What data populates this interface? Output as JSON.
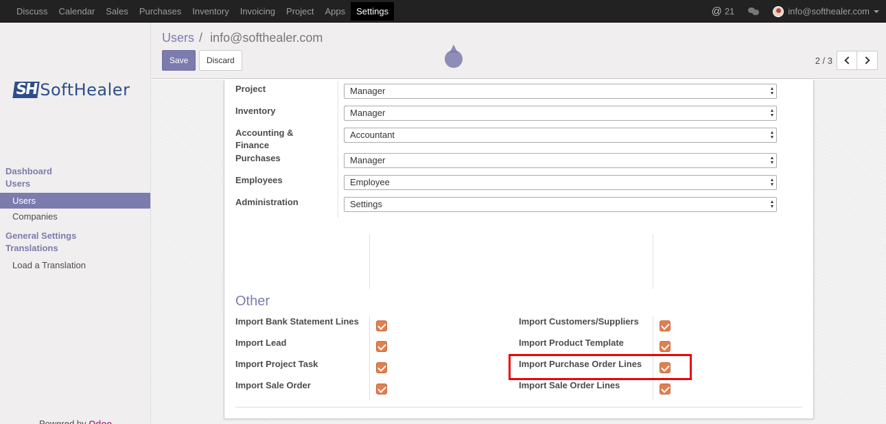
{
  "topbar": {
    "menu": [
      "Discuss",
      "Calendar",
      "Sales",
      "Purchases",
      "Inventory",
      "Invoicing",
      "Project",
      "Apps",
      "Settings"
    ],
    "active": "Settings",
    "mentions_count": "21",
    "user": "info@softhealer.com",
    "icons": {
      "mentions": "at-icon",
      "chat": "chat-icon",
      "user": "avatar"
    }
  },
  "sidebar": {
    "logo_mark": "SH",
    "logo_text": "SoftHealer",
    "groups": [
      {
        "label": "Dashboard",
        "items": []
      },
      {
        "label": "Users",
        "items": [
          "Users",
          "Companies"
        ]
      },
      {
        "label": "General Settings",
        "items": []
      },
      {
        "label": "Translations",
        "items": [
          "Load a Translation"
        ]
      }
    ],
    "active_item": "Users",
    "powered_prefix": "Powered by",
    "powered_brand": "Odoo"
  },
  "control": {
    "breadcrumb_parent": "Users",
    "breadcrumb_sep": "/",
    "breadcrumb_current": "info@softhealer.com",
    "save_label": "Save",
    "discard_label": "Discard",
    "pager": "2 / 3"
  },
  "access_rights": [
    {
      "label": "Project",
      "value": "Manager"
    },
    {
      "label": "Inventory",
      "value": "Manager"
    },
    {
      "label": "Accounting &\nFinance",
      "value": "Accountant"
    },
    {
      "label": "Purchases",
      "value": "Manager"
    },
    {
      "label": "Employees",
      "value": "Employee"
    },
    {
      "label": "Administration",
      "value": "Settings"
    }
  ],
  "other": {
    "title": "Other",
    "left": [
      {
        "label": "Import Bank Statement Lines",
        "checked": true
      },
      {
        "label": "Import Lead",
        "checked": true
      },
      {
        "label": "Import Project Task",
        "checked": true
      },
      {
        "label": "Import Sale Order",
        "checked": true
      }
    ],
    "right": [
      {
        "label": "Import Customers/Suppliers",
        "checked": true
      },
      {
        "label": "Import Product Template",
        "checked": true
      },
      {
        "label": "Import Purchase Order Lines",
        "checked": true
      },
      {
        "label": "Import Sale Order Lines",
        "checked": true
      }
    ],
    "highlight_color": "#e00000"
  },
  "colors": {
    "brand": "#7c7bad",
    "checkbox": "#e17f4f",
    "navbar": "#222222"
  }
}
